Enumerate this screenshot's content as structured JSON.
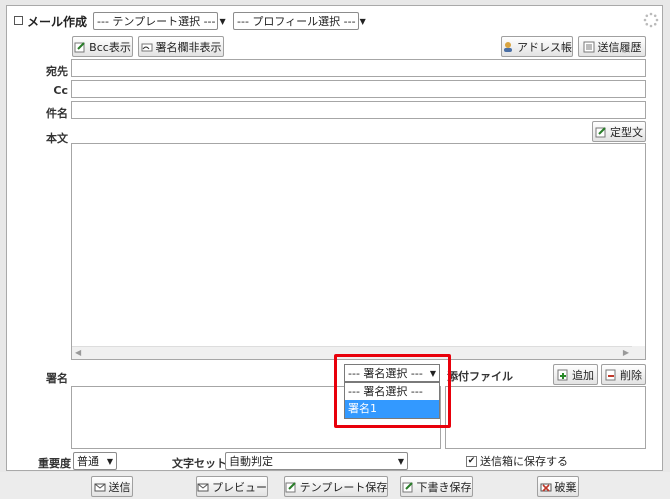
{
  "header": {
    "title": "メール作成",
    "template_select": "--- テンプレート選択 ---",
    "profile_select": "--- プロフィール選択 ---"
  },
  "toolbar": {
    "bcc_label": "Bcc表示",
    "signature_toggle_label": "署名欄非表示",
    "address_book_label": "アドレス帳",
    "history_label": "送信履歴"
  },
  "fields": {
    "to_label": "宛先",
    "cc_label": "Cc",
    "subject_label": "件名",
    "body_label": "本文",
    "template_text_label": "定型文"
  },
  "signature": {
    "label": "署名",
    "select_value": "--- 署名選択 ---",
    "options": [
      "--- 署名選択 ---",
      "署名1"
    ],
    "highlighted_option": "署名1"
  },
  "attachments": {
    "label": "添付ファイル",
    "add_label": "追加",
    "delete_label": "削除",
    "save_to_sent_label": "送信箱に保存する",
    "save_to_sent_checked": true
  },
  "options": {
    "priority_label": "重要度",
    "priority_value": "普通",
    "charset_label": "文字セット",
    "charset_value": "自動判定"
  },
  "actions": {
    "send_label": "送信",
    "preview_label": "プレビュー",
    "save_template_label": "テンプレート保存",
    "save_draft_label": "下書き保存",
    "discard_label": "破棄"
  },
  "colors": {
    "highlight_border": "#e8000b",
    "selected_option_bg": "#3399ff"
  }
}
